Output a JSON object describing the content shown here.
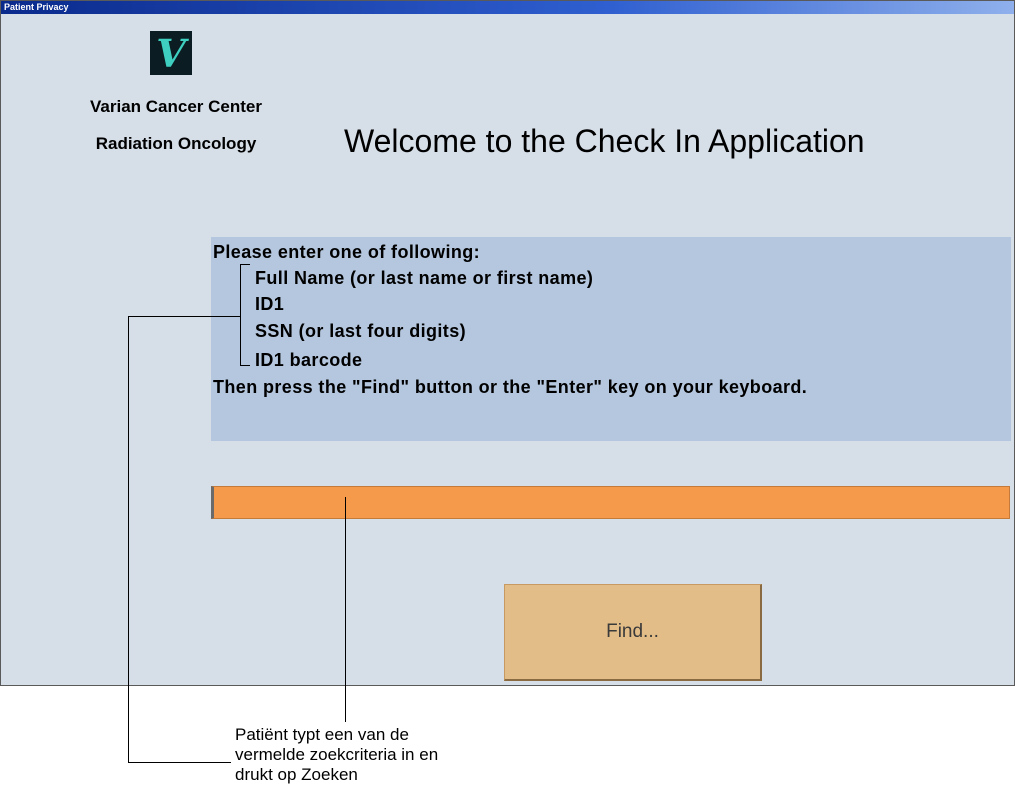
{
  "window": {
    "title": "Patient Privacy"
  },
  "logo": {
    "letter": "V",
    "accent_color": "#3ecfc0",
    "background_color": "#0b1c22"
  },
  "org": {
    "name": "Varian Cancer Center",
    "department": "Radiation Oncology"
  },
  "welcome": "Welcome to the Check In Application",
  "instructions": {
    "heading": "Please enter one of following:",
    "options": [
      "Full Name (or last name or first name)",
      "ID1",
      "SSN (or last four digits)",
      "ID1 barcode"
    ],
    "footer": "Then press the \"Find\" button or the \"Enter\" key on your keyboard."
  },
  "search": {
    "value": "",
    "placeholder": "",
    "color": "#f59a4a"
  },
  "find_button": {
    "label": "Find...",
    "color": "#e3bd88"
  },
  "annotation": {
    "lines": [
      "Patiënt typt een van de",
      "vermelde zoekcriteria in en",
      "drukt op Zoeken"
    ]
  }
}
